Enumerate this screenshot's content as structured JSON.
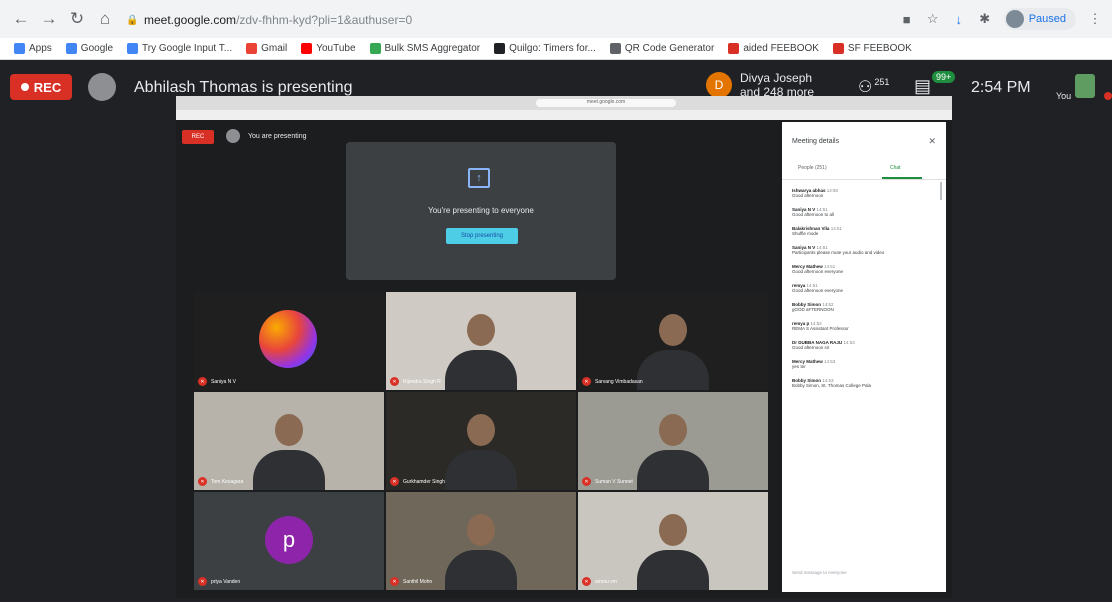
{
  "browser": {
    "url_host": "meet.google.com",
    "url_path": "/zdv-fhhm-kyd?pli=1&authuser=0",
    "profile_status": "Paused",
    "bookmarks": [
      "Apps",
      "Google",
      "Try Google Input T...",
      "Gmail",
      "YouTube",
      "Bulk SMS Aggregator",
      "Quilgo: Timers for...",
      "QR Code Generator",
      "aided FEEBOOK",
      "SF FEEBOOK"
    ],
    "bookmark_colors": [
      "#4285f4",
      "#4285f4",
      "#4285f4",
      "#ea4335",
      "#ff0000",
      "#34a853",
      "#202124",
      "#5f6368",
      "#d93025",
      "#d93025"
    ]
  },
  "meet": {
    "rec_label": "REC",
    "presenter_text": "Abhilash Thomas is presenting",
    "speaker_initial": "D",
    "speaker_name": "Divya Joseph",
    "speaker_more": "and 248 more",
    "people_count": "251",
    "chat_badge": "99+",
    "time": "2:54 PM",
    "you_label": "You"
  },
  "shared_screen": {
    "rec_label": "REC",
    "presenting_label": "You are presenting",
    "inner_url": "meet.google.com",
    "present_message": "You're presenting to everyone",
    "stop_button": "Stop presenting",
    "tiles": [
      {
        "name": "Saniya N V",
        "bg": "#1f1f1f"
      },
      {
        "name": "Rijendra Singh R",
        "bg": "#cfcbc4"
      },
      {
        "name": "Sarvang Vimbadasan",
        "bg": "#1f1f1f"
      },
      {
        "name": "Tom Kesagara",
        "bg": "#b7b3ab"
      },
      {
        "name": "Gurkhamder Singh",
        "bg": "#2b2a27"
      },
      {
        "name": "Suman V Sunnet",
        "bg": "#9b9a93"
      },
      {
        "name": "priya Vanden",
        "bg": "#3c4043"
      },
      {
        "name": "Santhil Mohn",
        "bg": "#6f6759"
      },
      {
        "name": "ammu vm",
        "bg": "#c9c6bf"
      }
    ],
    "panel": {
      "title": "Meeting details",
      "tab_people": "People (251)",
      "tab_chat": "Chat",
      "messages": [
        {
          "name": "Ishwarya abhas",
          "time": "14:50",
          "text": "Good afternoon"
        },
        {
          "name": "Saniya N V",
          "time": "14:51",
          "text": "Good afternoon to all"
        },
        {
          "name": "Balakrishnan Vila",
          "time": "14:51",
          "text": "Shuffle mode"
        },
        {
          "name": "Saniya N V",
          "time": "14:51",
          "text": "Participants please mute your audio and video"
        },
        {
          "name": "Mercy Mathew",
          "time": "14:51",
          "text": "Good afternoon everyone"
        },
        {
          "name": "remya",
          "time": "14:51",
          "text": "Good afternoon everyone"
        },
        {
          "name": "Bobby Simon",
          "time": "14:52",
          "text": "gOOD aFTERNOON"
        },
        {
          "name": "remya p",
          "time": "14:52",
          "text": "REMA S Assistant Professor"
        },
        {
          "name": "Dr DUBBA NAGA RAJU",
          "time": "14:53",
          "text": "Good afternoon sir"
        },
        {
          "name": "Mercy Mathew",
          "time": "14:53",
          "text": "yes Sir"
        },
        {
          "name": "Bobby Simon",
          "time": "14:53",
          "text": "Bobby Simon, St. Thomas College Pala"
        }
      ],
      "send_placeholder": "Send message to everyone"
    }
  }
}
